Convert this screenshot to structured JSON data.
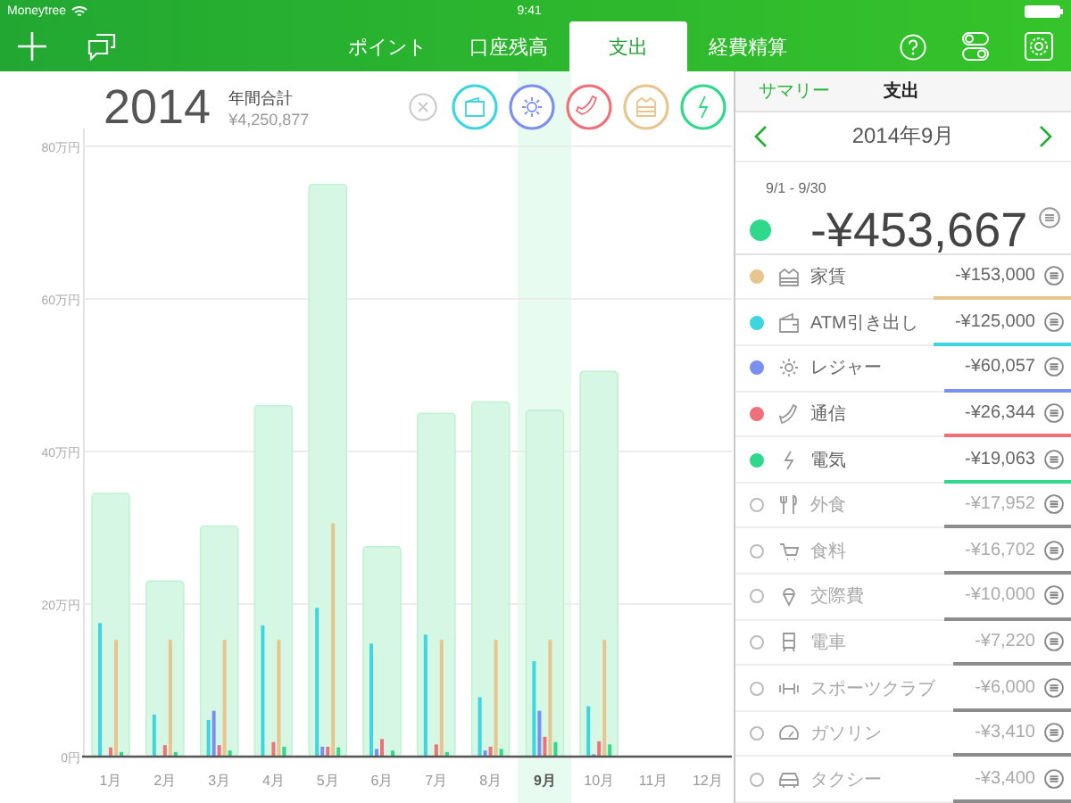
{
  "status_bar": {
    "carrier": "Moneytree",
    "time": "9:41"
  },
  "tabs": [
    {
      "label": "ポイント",
      "selected": false
    },
    {
      "label": "口座残高",
      "selected": false
    },
    {
      "label": "支出",
      "selected": true
    },
    {
      "label": "経費精算",
      "selected": false
    }
  ],
  "year_summary": {
    "year": "2014",
    "label": "年間合計",
    "total": "¥4,250,877"
  },
  "filters": [
    {
      "kind": "clear"
    },
    {
      "kind": "category",
      "color": "#3dd6e0"
    },
    {
      "kind": "category",
      "color": "#7b8ff0"
    },
    {
      "kind": "category",
      "color": "#f0707a"
    },
    {
      "kind": "category",
      "color": "#e8c48e"
    },
    {
      "kind": "category",
      "color": "#2fd88a"
    }
  ],
  "months": [
    {
      "selected": false
    },
    {
      "selected": false
    },
    {
      "selected": false
    },
    {
      "selected": false
    },
    {
      "selected": false
    },
    {
      "selected": false
    },
    {
      "selected": false
    },
    {
      "selected": false
    },
    {
      "selected": true
    },
    {
      "selected": false
    },
    {
      "selected": false
    },
    {
      "selected": false
    }
  ],
  "chart_data": {
    "type": "bar",
    "grid": true,
    "categories": [
      "1月",
      "2月",
      "3月",
      "4月",
      "5月",
      "6月",
      "7月",
      "8月",
      "9月",
      "10月",
      "11月",
      "12月"
    ],
    "ylim": [
      0,
      80
    ],
    "yticks": [
      {
        "value": 0,
        "label": "0円"
      },
      {
        "value": 20,
        "label": "20万円"
      },
      {
        "value": 40,
        "label": "40万円"
      },
      {
        "value": 60,
        "label": "60万円"
      },
      {
        "value": 80,
        "label": "80万円"
      }
    ],
    "series": [
      {
        "color": "#d6f7e3",
        "values": [
          34.5,
          23,
          30.2,
          46,
          75,
          27.5,
          45,
          46.5,
          45.4,
          50.5,
          null,
          null
        ]
      },
      {
        "color": "#3dd6e0",
        "values": [
          17.5,
          5.5,
          4.8,
          17.2,
          19.5,
          14.8,
          16,
          7.8,
          12.5,
          6.6,
          null,
          null
        ]
      },
      {
        "color": "#7b8ff0",
        "values": [
          0,
          0,
          6,
          0,
          1.3,
          1,
          0,
          0.8,
          6,
          0.3,
          null,
          null
        ]
      },
      {
        "color": "#f0707a",
        "values": [
          1.2,
          1.5,
          1.5,
          1.9,
          1.3,
          2.3,
          1.6,
          1.3,
          2.6,
          2,
          null,
          null
        ]
      },
      {
        "color": "#e8c48e",
        "values": [
          15.3,
          15.3,
          15.3,
          15.3,
          30.6,
          0,
          15.3,
          15.3,
          15.3,
          15.3,
          null,
          null
        ]
      },
      {
        "color": "#2fd88a",
        "values": [
          0.6,
          0.6,
          0.8,
          1.3,
          1.2,
          0.8,
          0.6,
          1,
          1.9,
          1.6,
          null,
          null
        ]
      }
    ]
  },
  "panel": {
    "back": "サマリー",
    "title": "支出",
    "month": "2014年9月",
    "range": "9/1 - 9/30",
    "amount": "-¥453,667",
    "color": "#2fd88a"
  },
  "items": [
    {
      "name": "家賃",
      "amount": "-¥153,000",
      "active": true,
      "color": "#e8c48e"
    },
    {
      "name": "ATM引き出し",
      "amount": "-¥125,000",
      "active": true,
      "color": "#3dd6e0"
    },
    {
      "name": "レジャー",
      "amount": "-¥60,057",
      "active": true,
      "color": "#7b8ff0"
    },
    {
      "name": "通信",
      "amount": "-¥26,344",
      "active": true,
      "color": "#f0707a"
    },
    {
      "name": "電気",
      "amount": "-¥19,063",
      "active": true,
      "color": "#2fd88a"
    },
    {
      "name": "外食",
      "amount": "-¥17,952",
      "active": false
    },
    {
      "name": "食料",
      "amount": "-¥16,702",
      "active": false
    },
    {
      "name": "交際費",
      "amount": "-¥10,000",
      "active": false
    },
    {
      "name": "電車",
      "amount": "-¥7,220",
      "active": false
    },
    {
      "name": "スポーツクラブ",
      "amount": "-¥6,000",
      "active": false
    },
    {
      "name": "ガソリン",
      "amount": "-¥3,410",
      "active": false
    },
    {
      "name": "タクシー",
      "amount": "-¥3,400",
      "active": false
    }
  ]
}
